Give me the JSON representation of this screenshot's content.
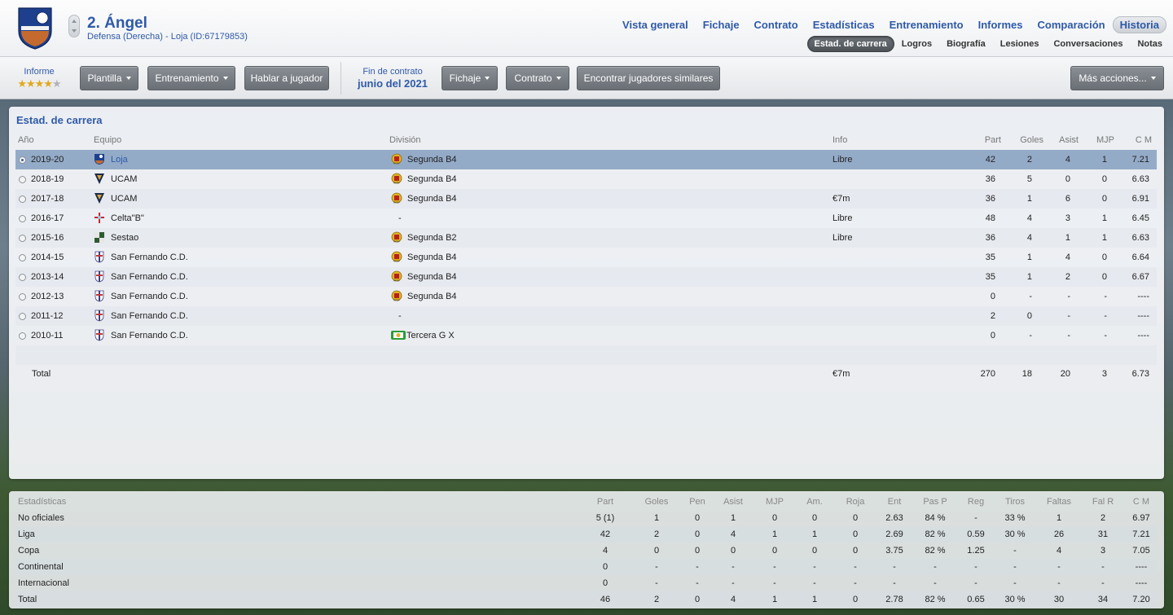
{
  "header": {
    "name": "2. Ángel",
    "subtitle": "Defensa (Derecha) - Loja (ID:67179853)",
    "nav": [
      "Vista general",
      "Fichaje",
      "Contrato",
      "Estadísticas",
      "Entrenamiento",
      "Informes",
      "Comparación",
      "Historia"
    ],
    "nav_active": "Historia",
    "subnav": [
      "Estad. de carrera",
      "Logros",
      "Biografía",
      "Lesiones",
      "Conversaciones",
      "Notas"
    ],
    "subnav_active": "Estad. de carrera"
  },
  "toolbar": {
    "report_label": "Informe",
    "rating_stars": 3.5,
    "rating_max": 5,
    "btn_squad": "Plantilla",
    "btn_training": "Entrenamiento",
    "btn_talk": "Hablar a jugador",
    "contract_label": "Fin de contrato",
    "contract_value": "junio del 2021",
    "btn_transfer": "Fichaje",
    "btn_contract": "Contrato",
    "btn_similar": "Encontrar jugadores similares",
    "btn_more": "Más acciones..."
  },
  "career": {
    "title": "Estad. de carrera",
    "columns": {
      "year": "Año",
      "team": "Equipo",
      "division": "División",
      "info": "Info",
      "apps": "Part",
      "goals": "Goles",
      "assists": "Asist",
      "pom": "MJP",
      "rating": "C M"
    },
    "rows": [
      {
        "year": "2019-20",
        "team": "Loja",
        "division": "Segunda B4",
        "info": "Libre",
        "apps": "42",
        "goals": "2",
        "assists": "4",
        "pom": "1",
        "rating": "7.21",
        "crest": "loja",
        "div_icon": "rfef"
      },
      {
        "year": "2018-19",
        "team": "UCAM",
        "division": "Segunda B4",
        "info": "",
        "apps": "36",
        "goals": "5",
        "assists": "0",
        "pom": "0",
        "rating": "6.63",
        "crest": "ucam",
        "div_icon": "rfef"
      },
      {
        "year": "2017-18",
        "team": "UCAM",
        "division": "Segunda B4",
        "info": "€7m",
        "apps": "36",
        "goals": "1",
        "assists": "6",
        "pom": "0",
        "rating": "6.91",
        "crest": "ucam",
        "div_icon": "rfef"
      },
      {
        "year": "2016-17",
        "team": "Celta\"B\"",
        "division": "-",
        "info": "Libre",
        "apps": "48",
        "goals": "4",
        "assists": "3",
        "pom": "1",
        "rating": "6.45",
        "crest": "celta",
        "div_icon": ""
      },
      {
        "year": "2015-16",
        "team": "Sestao",
        "division": "Segunda B2",
        "info": "Libre",
        "apps": "36",
        "goals": "4",
        "assists": "1",
        "pom": "1",
        "rating": "6.63",
        "crest": "sestao",
        "div_icon": "rfef"
      },
      {
        "year": "2014-15",
        "team": "San Fernando C.D.",
        "division": "Segunda B4",
        "info": "",
        "apps": "35",
        "goals": "1",
        "assists": "4",
        "pom": "0",
        "rating": "6.64",
        "crest": "sanfer",
        "div_icon": "rfef"
      },
      {
        "year": "2013-14",
        "team": "San Fernando C.D.",
        "division": "Segunda B4",
        "info": "",
        "apps": "35",
        "goals": "1",
        "assists": "2",
        "pom": "0",
        "rating": "6.67",
        "crest": "sanfer",
        "div_icon": "rfef"
      },
      {
        "year": "2012-13",
        "team": "San Fernando C.D.",
        "division": "Segunda B4",
        "info": "",
        "apps": "0",
        "goals": "-",
        "assists": "-",
        "pom": "-",
        "rating": "----",
        "crest": "sanfer",
        "div_icon": "rfef"
      },
      {
        "year": "2011-12",
        "team": "San Fernando C.D.",
        "division": "-",
        "info": "",
        "apps": "2",
        "goals": "0",
        "assists": "-",
        "pom": "-",
        "rating": "----",
        "crest": "sanfer",
        "div_icon": ""
      },
      {
        "year": "2010-11",
        "team": "San Fernando C.D.",
        "division": "Tercera G X",
        "info": "",
        "apps": "0",
        "goals": "-",
        "assists": "-",
        "pom": "-",
        "rating": "----",
        "crest": "sanfer",
        "div_icon": "andalucia"
      }
    ],
    "total": {
      "label": "Total",
      "info": "€7m",
      "apps": "270",
      "goals": "18",
      "assists": "20",
      "pom": "3",
      "rating": "6.73"
    }
  },
  "stats": {
    "columns": [
      "Estadísticas",
      "Part",
      "Goles",
      "Pen",
      "Asist",
      "MJP",
      "Am.",
      "Roja",
      "Ent",
      "Pas P",
      "Reg",
      "Tiros",
      "Faltas",
      "Fal R",
      "C M"
    ],
    "rows": [
      [
        "No oficiales",
        "5 (1)",
        "1",
        "0",
        "1",
        "0",
        "0",
        "0",
        "2.63",
        "84 %",
        "-",
        "33 %",
        "1",
        "2",
        "6.97"
      ],
      [
        "Liga",
        "42",
        "2",
        "0",
        "4",
        "1",
        "1",
        "0",
        "2.69",
        "82 %",
        "0.59",
        "30 %",
        "26",
        "31",
        "7.21"
      ],
      [
        "Copa",
        "4",
        "0",
        "0",
        "0",
        "0",
        "0",
        "0",
        "3.75",
        "82 %",
        "1.25",
        "-",
        "4",
        "3",
        "7.05"
      ],
      [
        "Continental",
        "0",
        "-",
        "-",
        "-",
        "-",
        "-",
        "-",
        "-",
        "-",
        "-",
        "-",
        "-",
        "-",
        "----"
      ],
      [
        "Internacional",
        "0",
        "-",
        "-",
        "-",
        "-",
        "-",
        "-",
        "-",
        "-",
        "-",
        "-",
        "-",
        "-",
        "----"
      ],
      [
        "Total",
        "46",
        "2",
        "0",
        "4",
        "1",
        "1",
        "0",
        "2.78",
        "82 %",
        "0.65",
        "30 %",
        "30",
        "34",
        "7.20"
      ]
    ]
  },
  "colors": {
    "accent": "#2f5aa8",
    "selected_row": "#94abc8",
    "star": "#e2a81c"
  }
}
